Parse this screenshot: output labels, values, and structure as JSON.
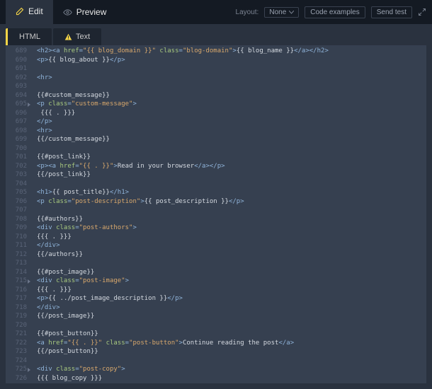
{
  "topbar": {
    "edit": "Edit",
    "preview": "Preview",
    "layout_label": "Layout:",
    "layout_value": "None",
    "code_examples": "Code examples",
    "send_test": "Send test"
  },
  "subtabs": {
    "html": "HTML",
    "text": "Text"
  },
  "gutter": {
    "start": 689,
    "end": 726,
    "marked": [
      695,
      715,
      725
    ]
  },
  "code_lines": [
    {
      "tokens": [
        [
          "<h2><a ",
          "t-tag"
        ],
        [
          "href",
          "t-attr"
        ],
        [
          "=",
          "t-tag"
        ],
        [
          "\"{{ blog_domain }}\"",
          "t-str"
        ],
        [
          " ",
          "t-tag"
        ],
        [
          "class",
          "t-attr"
        ],
        [
          "=",
          "t-tag"
        ],
        [
          "\"blog-domain\"",
          "t-str"
        ],
        [
          ">",
          "t-tag"
        ],
        [
          "{{ blog_name }}",
          "t-text"
        ],
        [
          "</a></h2>",
          "t-tag"
        ]
      ]
    },
    {
      "tokens": [
        [
          "<p>",
          "t-tag"
        ],
        [
          "{{ blog_about }}",
          "t-text"
        ],
        [
          "</p>",
          "t-tag"
        ]
      ]
    },
    {
      "tokens": [
        [
          "",
          "t-text"
        ]
      ]
    },
    {
      "tokens": [
        [
          "<hr>",
          "t-tag"
        ]
      ]
    },
    {
      "tokens": [
        [
          "",
          "t-text"
        ]
      ]
    },
    {
      "tokens": [
        [
          "{{#custom_message}}",
          "t-mu"
        ]
      ]
    },
    {
      "tokens": [
        [
          "<p ",
          "t-tag"
        ],
        [
          "class",
          "t-attr"
        ],
        [
          "=",
          "t-tag"
        ],
        [
          "\"custom-message\"",
          "t-str"
        ],
        [
          ">",
          "t-tag"
        ]
      ]
    },
    {
      "tokens": [
        [
          " {{{ . }}}",
          "t-text"
        ]
      ]
    },
    {
      "tokens": [
        [
          "</p>",
          "t-tag"
        ]
      ]
    },
    {
      "tokens": [
        [
          "<hr>",
          "t-tag"
        ]
      ]
    },
    {
      "tokens": [
        [
          "{{/custom_message}}",
          "t-mu"
        ]
      ]
    },
    {
      "tokens": [
        [
          "",
          "t-text"
        ]
      ]
    },
    {
      "tokens": [
        [
          "{{#post_link}}",
          "t-mu"
        ]
      ]
    },
    {
      "tokens": [
        [
          "<p><a ",
          "t-tag"
        ],
        [
          "href",
          "t-attr"
        ],
        [
          "=",
          "t-tag"
        ],
        [
          "\"{{ . }}\"",
          "t-str"
        ],
        [
          ">",
          "t-tag"
        ],
        [
          "Read in your browser",
          "t-text"
        ],
        [
          "</a></p>",
          "t-tag"
        ]
      ]
    },
    {
      "tokens": [
        [
          "{{/post_link}}",
          "t-mu"
        ]
      ]
    },
    {
      "tokens": [
        [
          "",
          "t-text"
        ]
      ]
    },
    {
      "tokens": [
        [
          "<h1>",
          "t-tag"
        ],
        [
          "{{ post_title}}",
          "t-text"
        ],
        [
          "</h1>",
          "t-tag"
        ]
      ]
    },
    {
      "tokens": [
        [
          "<p ",
          "t-tag"
        ],
        [
          "class",
          "t-attr"
        ],
        [
          "=",
          "t-tag"
        ],
        [
          "\"post-description\"",
          "t-str"
        ],
        [
          ">",
          "t-tag"
        ],
        [
          "{{ post_description }}",
          "t-text"
        ],
        [
          "</p>",
          "t-tag"
        ]
      ]
    },
    {
      "tokens": [
        [
          "",
          "t-text"
        ]
      ]
    },
    {
      "tokens": [
        [
          "{{#authors}}",
          "t-mu"
        ]
      ]
    },
    {
      "tokens": [
        [
          "<div ",
          "t-tag"
        ],
        [
          "class",
          "t-attr"
        ],
        [
          "=",
          "t-tag"
        ],
        [
          "\"post-authors\"",
          "t-str"
        ],
        [
          ">",
          "t-tag"
        ]
      ]
    },
    {
      "tokens": [
        [
          "{{{ . }}}",
          "t-text"
        ]
      ]
    },
    {
      "tokens": [
        [
          "</div>",
          "t-tag"
        ]
      ]
    },
    {
      "tokens": [
        [
          "{{/authors}}",
          "t-mu"
        ]
      ]
    },
    {
      "tokens": [
        [
          "",
          "t-text"
        ]
      ]
    },
    {
      "tokens": [
        [
          "{{#post_image}}",
          "t-mu"
        ]
      ]
    },
    {
      "tokens": [
        [
          "<div ",
          "t-tag"
        ],
        [
          "class",
          "t-attr"
        ],
        [
          "=",
          "t-tag"
        ],
        [
          "\"post-image\"",
          "t-str"
        ],
        [
          ">",
          "t-tag"
        ]
      ]
    },
    {
      "tokens": [
        [
          "{{{ . }}}",
          "t-text"
        ]
      ]
    },
    {
      "tokens": [
        [
          "<p>",
          "t-tag"
        ],
        [
          "{{ ../post_image_description }}",
          "t-text"
        ],
        [
          "</p>",
          "t-tag"
        ]
      ]
    },
    {
      "tokens": [
        [
          "</div>",
          "t-tag"
        ]
      ]
    },
    {
      "tokens": [
        [
          "{{/post_image}}",
          "t-mu"
        ]
      ]
    },
    {
      "tokens": [
        [
          "",
          "t-text"
        ]
      ]
    },
    {
      "tokens": [
        [
          "{{#post_button}}",
          "t-mu"
        ]
      ]
    },
    {
      "tokens": [
        [
          "<a ",
          "t-tag"
        ],
        [
          "href",
          "t-attr"
        ],
        [
          "=",
          "t-tag"
        ],
        [
          "\"{{ . }}\"",
          "t-str"
        ],
        [
          " ",
          "t-tag"
        ],
        [
          "class",
          "t-attr"
        ],
        [
          "=",
          "t-tag"
        ],
        [
          "\"post-button\"",
          "t-str"
        ],
        [
          ">",
          "t-tag"
        ],
        [
          "Continue reading the post",
          "t-text"
        ],
        [
          "</a>",
          "t-tag"
        ]
      ]
    },
    {
      "tokens": [
        [
          "{{/post_button}}",
          "t-mu"
        ]
      ]
    },
    {
      "tokens": [
        [
          "",
          "t-text"
        ]
      ]
    },
    {
      "tokens": [
        [
          "<div ",
          "t-tag"
        ],
        [
          "class",
          "t-attr"
        ],
        [
          "=",
          "t-tag"
        ],
        [
          "\"post-copy\"",
          "t-str"
        ],
        [
          ">",
          "t-tag"
        ]
      ]
    },
    {
      "tokens": [
        [
          "{{{ blog_copy }}}",
          "t-text"
        ]
      ]
    }
  ]
}
